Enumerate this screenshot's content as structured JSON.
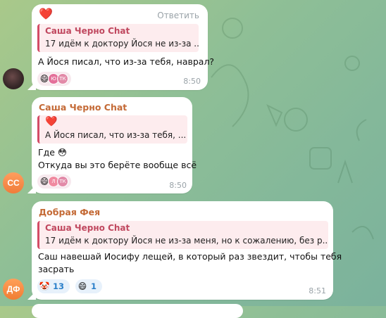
{
  "messages": [
    {
      "reaction_top": "❤️",
      "answer_label": "Ответить",
      "reply": {
        "name": "Саша Черно Chat",
        "text": "17 идём к доктору Йося не из-за ..."
      },
      "text": "А Йося писал, что из-за тебя, наврал?",
      "reactions": [
        {
          "emoji": "😄",
          "avatars": [
            "Ю",
            "ТК"
          ]
        }
      ],
      "time": "8:50"
    },
    {
      "sender": "Саша Черно Chat",
      "reply": {
        "emoji": "❤️",
        "text": "А Йося писал, что из-за тебя, ..."
      },
      "lines": [
        "Где 😳",
        "Откуда вы это берёте вообще всё"
      ],
      "reactions": [
        {
          "emoji": "😄",
          "avatars": [
            "Л",
            "ТК"
          ]
        }
      ],
      "time": "8:50",
      "avatar": "СС"
    },
    {
      "sender": "Добрая Фея",
      "reply": {
        "name": "Саша Черно Chat",
        "text": "17 идём к доктору Йося не из-за меня, но к сожалению, без р..."
      },
      "lines": [
        "Саш навешай Иосифу лещей, в который раз звездит, чтобы тебя",
        "засрать"
      ],
      "reactions": [
        {
          "emoji": "🤡",
          "count": "13"
        },
        {
          "emoji": "😄",
          "count": "1"
        }
      ],
      "time": "8:51",
      "avatar": "ДФ"
    }
  ],
  "colors": {
    "sender_orange": "#c46a36",
    "reply_pink": "#c0485f",
    "reaction_blue": "#2a7fc9"
  }
}
